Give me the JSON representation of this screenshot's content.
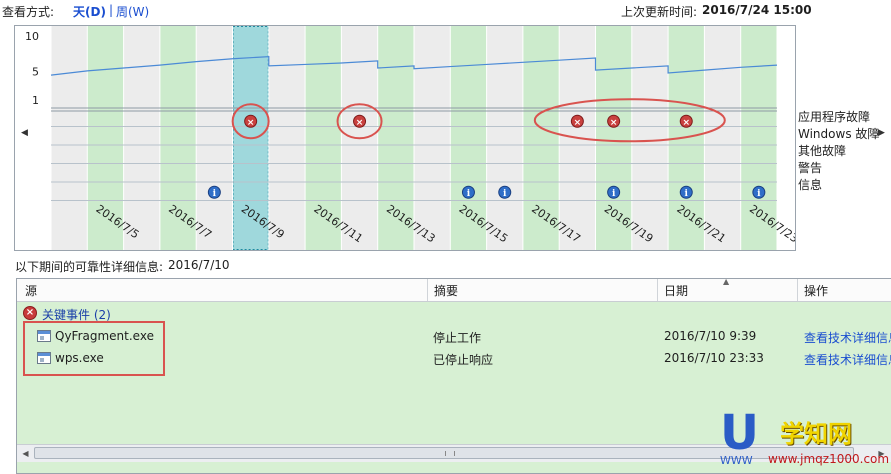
{
  "header": {
    "view_label": "查看方式:",
    "view_day": "天(D)",
    "view_sep": "|",
    "view_week": "周(W)",
    "updated_label": "上次更新时间:",
    "updated_value": "2016/7/24 15:00"
  },
  "chart": {
    "y_ticks": [
      "10",
      "5",
      "1"
    ],
    "x_labels": [
      "2016/7/5",
      "2016/7/7",
      "2016/7/9",
      "2016/7/11",
      "2016/7/13",
      "2016/7/15",
      "2016/7/17",
      "2016/7/19",
      "2016/7/21",
      "2016/7/23"
    ],
    "legend": [
      "应用程序故障",
      "Windows 故障",
      "其他故障",
      "警告",
      "信息"
    ],
    "selected_column": 5,
    "app_failure_columns": [
      5,
      8,
      14,
      15,
      17
    ],
    "info_columns": [
      4,
      11,
      12,
      15,
      17,
      19
    ],
    "colors": {
      "green": "#ccebcc",
      "gray": "#ececec",
      "selected": "#9fd8dc",
      "line": "#4b8ad6",
      "error": "#c9413f",
      "info": "#2f6ec8",
      "annotation": "#d9534f"
    }
  },
  "chart_data": {
    "type": "line",
    "title": "",
    "xlabel": "",
    "ylabel": "",
    "ylim": [
      1,
      10
    ],
    "x": [
      "2016/7/4",
      "2016/7/5",
      "2016/7/6",
      "2016/7/7",
      "2016/7/8",
      "2016/7/9",
      "2016/7/10",
      "2016/7/11",
      "2016/7/12",
      "2016/7/13",
      "2016/7/14",
      "2016/7/15",
      "2016/7/16",
      "2016/7/17",
      "2016/7/18",
      "2016/7/19",
      "2016/7/20",
      "2016/7/21",
      "2016/7/22",
      "2016/7/23"
    ],
    "series": [
      {
        "values": [
          4.5,
          5.1,
          5.5,
          5.9,
          6.4,
          6.8,
          5.8,
          6.0,
          6.2,
          5.5,
          5.4,
          5.7,
          6.0,
          6.3,
          6.6,
          5.2,
          5.5,
          4.8,
          5.2,
          5.6
        ]
      }
    ]
  },
  "details": {
    "title": "以下期间的可靠性详细信息:",
    "date": "2016/7/10"
  },
  "table": {
    "columns": [
      "源",
      "摘要",
      "日期",
      "操作"
    ],
    "group_label": "关键事件 (2)",
    "rows": [
      {
        "source": "QyFragment.exe",
        "summary": "停止工作",
        "date": "2016/7/10 9:39",
        "action": "查看技术详细信息"
      },
      {
        "source": "wps.exe",
        "summary": "已停止响应",
        "date": "2016/7/10 23:33",
        "action": "查看技术详细信息"
      }
    ]
  },
  "watermark": {
    "letter": "U",
    "title": "学知网",
    "www": "WWW",
    "url": "www.jmqz1000.com"
  }
}
